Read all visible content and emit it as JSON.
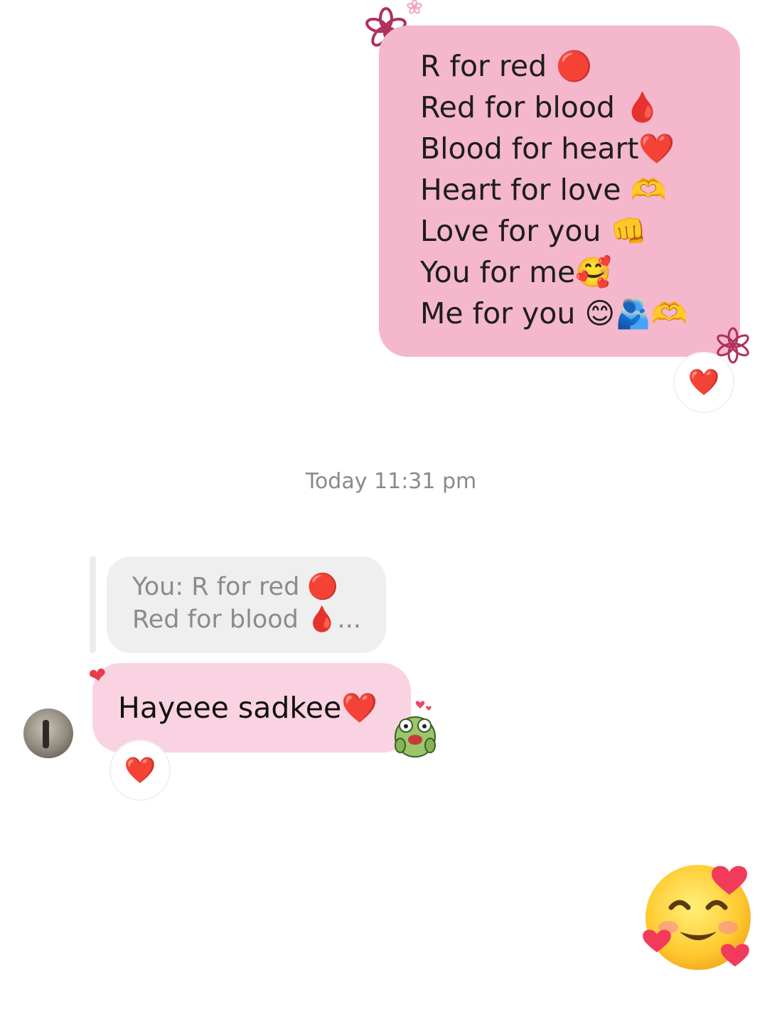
{
  "outgoing_message": {
    "lines": [
      "R for red 🔴",
      "Red for blood 🩸",
      "Blood for heart❤️",
      "Heart for love 🫶",
      "Love for you 👊",
      "You for me🥰",
      "Me for you 😊🫂🫶"
    ],
    "reaction": "❤️"
  },
  "timestamp": "Today 11:31 pm",
  "reply_quote": {
    "line1": "You: R for red 🔴",
    "line2": "Red for blood 🩸..."
  },
  "incoming_message": {
    "text": "Hayeee sadkee❤️",
    "reaction": "❤️",
    "liked_indicator": "❤"
  },
  "sent_emoji": "🥰",
  "colors": {
    "outgoing_bubble": "#f4b7cb",
    "incoming_bubble": "#fad3e2",
    "quote_bubble": "#efefef",
    "timestamp_text": "#8a8a8a"
  },
  "icons": {
    "flower_decoration": "flower-icon",
    "sticker": "frog-sticker-icon"
  }
}
